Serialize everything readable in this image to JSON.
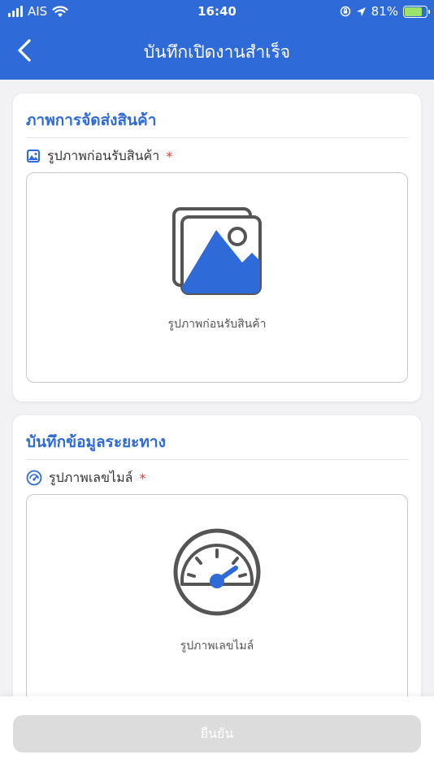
{
  "status_bar": {
    "carrier": "AIS",
    "time": "16:40",
    "battery": "81%"
  },
  "header": {
    "title": "บันทึกเปิดงานสำเร็จ"
  },
  "section_photo": {
    "title": "ภาพการจัดส่งสินค้า",
    "field_label": "รูปภาพก่อนรับสินค้า",
    "required_mark": "*",
    "upload_hint": "รูปภาพก่อนรับสินค้า"
  },
  "section_distance": {
    "title": "บันทึกข้อมูลระยะทาง",
    "field_label": "รูปภาพเลขไมล์",
    "required_mark": "*",
    "upload_hint": "รูปภาพเลขไมล์"
  },
  "footer": {
    "confirm_label": "ยืนยัน"
  },
  "colors": {
    "primary": "#2f6ad9",
    "required": "#e53935",
    "disabled_button": "#dcdcdc"
  }
}
